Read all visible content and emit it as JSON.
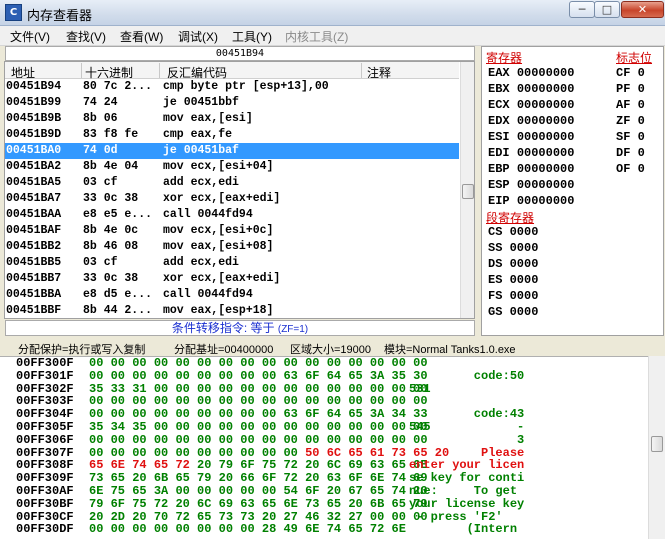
{
  "window": {
    "title": "内存查看器",
    "icon_label": "C",
    "min": "─",
    "max": "□",
    "close": "✕"
  },
  "menu": [
    {
      "label": "文件(V)",
      "enabled": true
    },
    {
      "label": "查找(V)",
      "enabled": true
    },
    {
      "label": "查看(W)",
      "enabled": true
    },
    {
      "label": "调试(X)",
      "enabled": true
    },
    {
      "label": "工具(Y)",
      "enabled": true
    },
    {
      "label": "内核工具(Z)",
      "enabled": false
    }
  ],
  "address_bar": "00451B94",
  "disasm": {
    "headers": {
      "address": "地址",
      "hex": "十六进制",
      "code": "反汇编代码",
      "comment": "注释"
    },
    "rows": [
      {
        "addr": "00451B94",
        "bytes": "80 7c 2...",
        "code": "cmp byte ptr [esp+13],00"
      },
      {
        "addr": "00451B99",
        "bytes": "74 24",
        "code": "je 00451bbf"
      },
      {
        "addr": "00451B9B",
        "bytes": "8b 06",
        "code": "mov eax,[esi]"
      },
      {
        "addr": "00451B9D",
        "bytes": "83 f8 fe",
        "code": "cmp eax,fe"
      },
      {
        "addr": "00451BA0",
        "bytes": "74 0d",
        "code": "je 00451baf",
        "selected": true
      },
      {
        "addr": "00451BA2",
        "bytes": "8b 4e 04",
        "code": "mov ecx,[esi+04]"
      },
      {
        "addr": "00451BA5",
        "bytes": "03 cf",
        "code": "add ecx,edi"
      },
      {
        "addr": "00451BA7",
        "bytes": "33 0c 38",
        "code": "xor ecx,[eax+edi]"
      },
      {
        "addr": "00451BAA",
        "bytes": "e8 e5 e...",
        "code": "call 0044fd94"
      },
      {
        "addr": "00451BAF",
        "bytes": "8b 4e 0c",
        "code": "mov ecx,[esi+0c]"
      },
      {
        "addr": "00451BB2",
        "bytes": "8b 46 08",
        "code": "mov eax,[esi+08]"
      },
      {
        "addr": "00451BB5",
        "bytes": "03 cf",
        "code": "add ecx,edi"
      },
      {
        "addr": "00451BB7",
        "bytes": "33 0c 38",
        "code": "xor ecx,[eax+edi]"
      },
      {
        "addr": "00451BBA",
        "bytes": "e8 d5 e...",
        "code": "call 0044fd94"
      },
      {
        "addr": "00451BBF",
        "bytes": "8b 44 2...",
        "code": "mov eax,[esp+18]"
      }
    ]
  },
  "condition_text": "条件转移指令: 等于",
  "condition_flag": "(ZF=1)",
  "registers": {
    "title": "寄存器",
    "flags_title": "标志位",
    "segment_title": "段寄存器",
    "general": [
      {
        "name": "EAX",
        "value": "00000000"
      },
      {
        "name": "EBX",
        "value": "00000000"
      },
      {
        "name": "ECX",
        "value": "00000000"
      },
      {
        "name": "EDX",
        "value": "00000000"
      },
      {
        "name": "ESI",
        "value": "00000000"
      },
      {
        "name": "EDI",
        "value": "00000000"
      },
      {
        "name": "EBP",
        "value": "00000000"
      },
      {
        "name": "ESP",
        "value": "00000000"
      },
      {
        "name": "EIP",
        "value": "00000000"
      }
    ],
    "flags": [
      {
        "name": "CF",
        "value": "0"
      },
      {
        "name": "PF",
        "value": "0"
      },
      {
        "name": "AF",
        "value": "0"
      },
      {
        "name": "ZF",
        "value": "0"
      },
      {
        "name": "SF",
        "value": "0"
      },
      {
        "name": "DF",
        "value": "0"
      },
      {
        "name": "OF",
        "value": "0"
      }
    ],
    "segments": [
      {
        "name": "CS",
        "value": "0000"
      },
      {
        "name": "SS",
        "value": "0000"
      },
      {
        "name": "DS",
        "value": "0000"
      },
      {
        "name": "ES",
        "value": "0000"
      },
      {
        "name": "FS",
        "value": "0000"
      },
      {
        "name": "GS",
        "value": "0000"
      }
    ]
  },
  "status": {
    "protection": "分配保护=执行或写入复制",
    "base": "分配基址=00400000",
    "size": "区域大小=19000",
    "module": "模块=Normal Tanks1.0.exe"
  },
  "hexdump": [
    {
      "addr": "00FF300F",
      "bytes": "00 00 00 00 00 00 00 00 00 00 00 00 00 00 00 00",
      "ascii": ""
    },
    {
      "addr": "00FF301F",
      "bytes": "00 00 00 00 00 00 00 00 00 63 6F 64 65 3A 35 30",
      "ascii": "         code:50"
    },
    {
      "addr": "00FF302F",
      "bytes": "35 33 31 00 00 00 00 00 00 00 00 00 00 00 00 00",
      "ascii": "531"
    },
    {
      "addr": "00FF303F",
      "bytes": "00 00 00 00 00 00 00 00 00 00 00 00 00 00 00 00",
      "ascii": ""
    },
    {
      "addr": "00FF304F",
      "bytes": "00 00 00 00 00 00 00 00 00 63 6F 64 65 3A 34 33",
      "ascii": "         code:43"
    },
    {
      "addr": "00FF305F",
      "bytes": "35 34 35 00 00 00 00 00 00 00 00 00 00 00 00 00",
      "ascii": "545            -"
    },
    {
      "addr": "00FF306F",
      "bytes": "00 00 00 00 00 00 00 00 00 00 00 00 00 00 00 00",
      "ascii": "               3"
    },
    {
      "addr": "00FF307F",
      "bytes": "00 00 00 00 00 00 00 00 00 00 50 6C 65 61 73 65 20",
      "ascii": "          Please ",
      "red_from": 10
    },
    {
      "addr": "00FF308F",
      "bytes": "65 6E 74 65 72 20 79 6F 75 72 20 6C 69 63 65 6E",
      "ascii": "enter your licen",
      "red_to": 5
    },
    {
      "addr": "00FF309F",
      "bytes": "73 65 20 6B 65 79 20 66 6F 72 20 63 6F 6E 74 69",
      "ascii": "se key for conti"
    },
    {
      "addr": "00FF30AF",
      "bytes": "6E 75 65 3A 00 00 00 00 00 54 6F 20 67 65 74 20",
      "ascii": "nue:     To get "
    },
    {
      "addr": "00FF30BF",
      "bytes": "79 6F 75 72 20 6C 69 63 65 6E 73 65 20 6B 65 79",
      "ascii": "your license key"
    },
    {
      "addr": "00FF30CF",
      "bytes": "20 2D 20 70 72 65 73 73 20 27 46 32 27 00 00 00",
      "ascii": " - press 'F2'"
    },
    {
      "addr": "00FF30DF",
      "bytes": "00 00 00 00 00 00 00 00 28 49 6E 74 65 72 6E",
      "ascii": "        (Intern"
    }
  ]
}
